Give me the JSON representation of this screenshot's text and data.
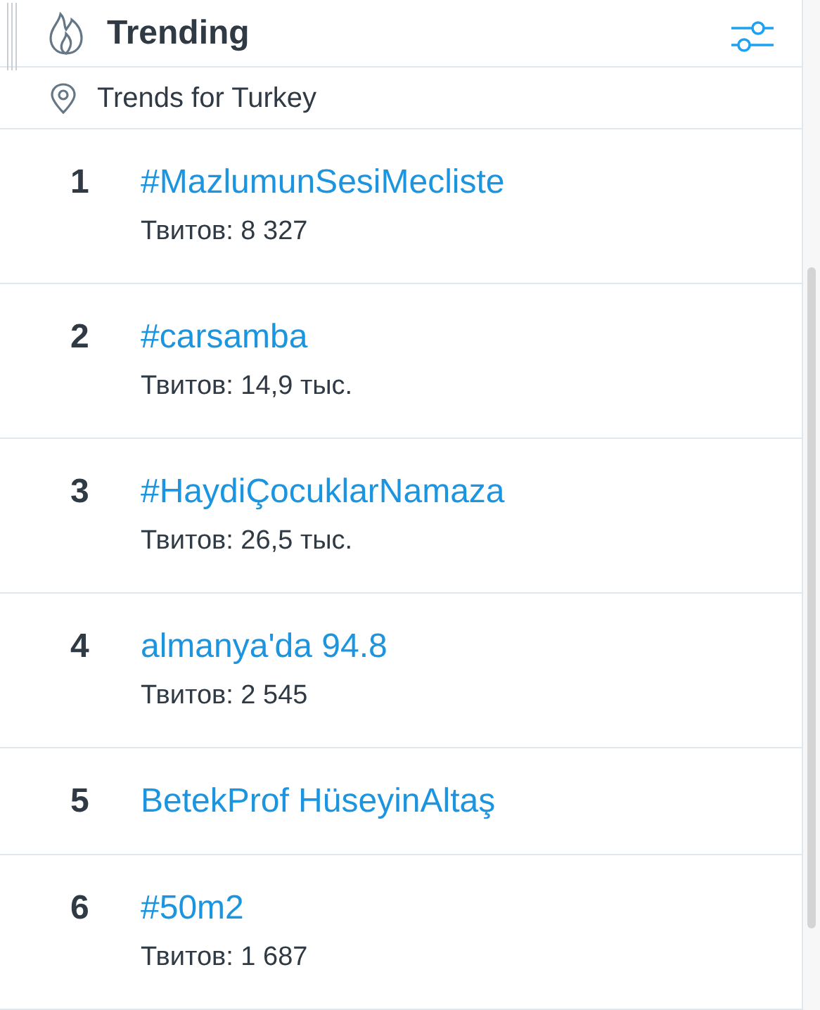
{
  "header": {
    "title": "Trending"
  },
  "location": {
    "label": "Trends for Turkey"
  },
  "trends": [
    {
      "rank": "1",
      "name": "#MazlumunSesiMecliste",
      "count": "Твитов: 8 327"
    },
    {
      "rank": "2",
      "name": "#carsamba",
      "count": "Твитов: 14,9 тыс."
    },
    {
      "rank": "3",
      "name": "#HaydiÇocuklarNamaza",
      "count": "Твитов: 26,5 тыс."
    },
    {
      "rank": "4",
      "name": "almanya'da 94.8",
      "count": "Твитов: 2 545"
    },
    {
      "rank": "5",
      "name": "BetekProf HüseyinAltaş"
    },
    {
      "rank": "6",
      "name": "#50m2",
      "count": "Твитов: 1 687"
    }
  ]
}
